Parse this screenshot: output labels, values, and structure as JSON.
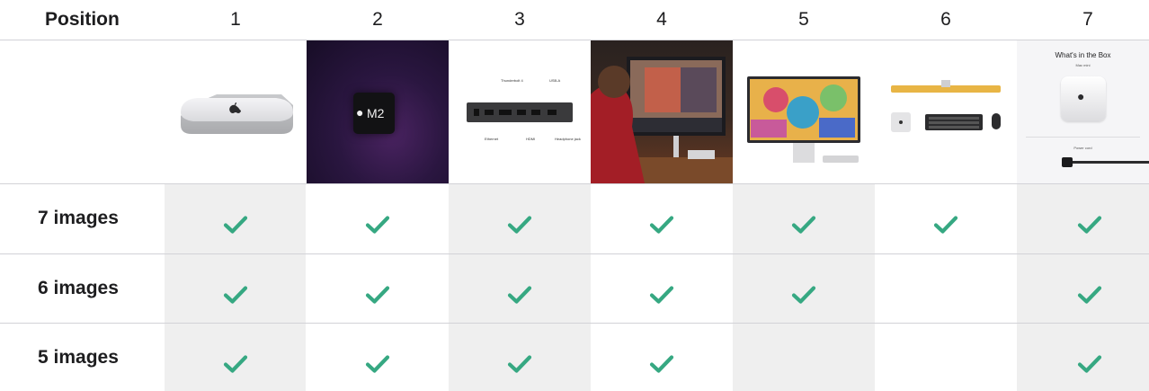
{
  "header": {
    "position_label": "Position",
    "positions": [
      "1",
      "2",
      "3",
      "4",
      "5",
      "6",
      "7"
    ]
  },
  "images": {
    "m2_chip_label": "M2",
    "ports_labels": [
      "Thunderbolt 4",
      "USB-A",
      "Ethernet",
      "HDMI",
      "Headphone jack"
    ],
    "box_title": "What's in the Box",
    "box_subtitle": "Mac mini",
    "box_cord": "Power cord"
  },
  "rows": [
    {
      "label": "7 images",
      "checks": [
        true,
        true,
        true,
        true,
        true,
        true,
        true
      ]
    },
    {
      "label": "6 images",
      "checks": [
        true,
        true,
        true,
        true,
        true,
        false,
        true
      ]
    },
    {
      "label": "5 images",
      "checks": [
        true,
        true,
        true,
        true,
        false,
        false,
        true
      ]
    }
  ],
  "colors": {
    "check": "#36a882",
    "shade": "#efefef",
    "rule": "#d2d2d7"
  },
  "icons": {
    "check": "checkmark-icon"
  }
}
